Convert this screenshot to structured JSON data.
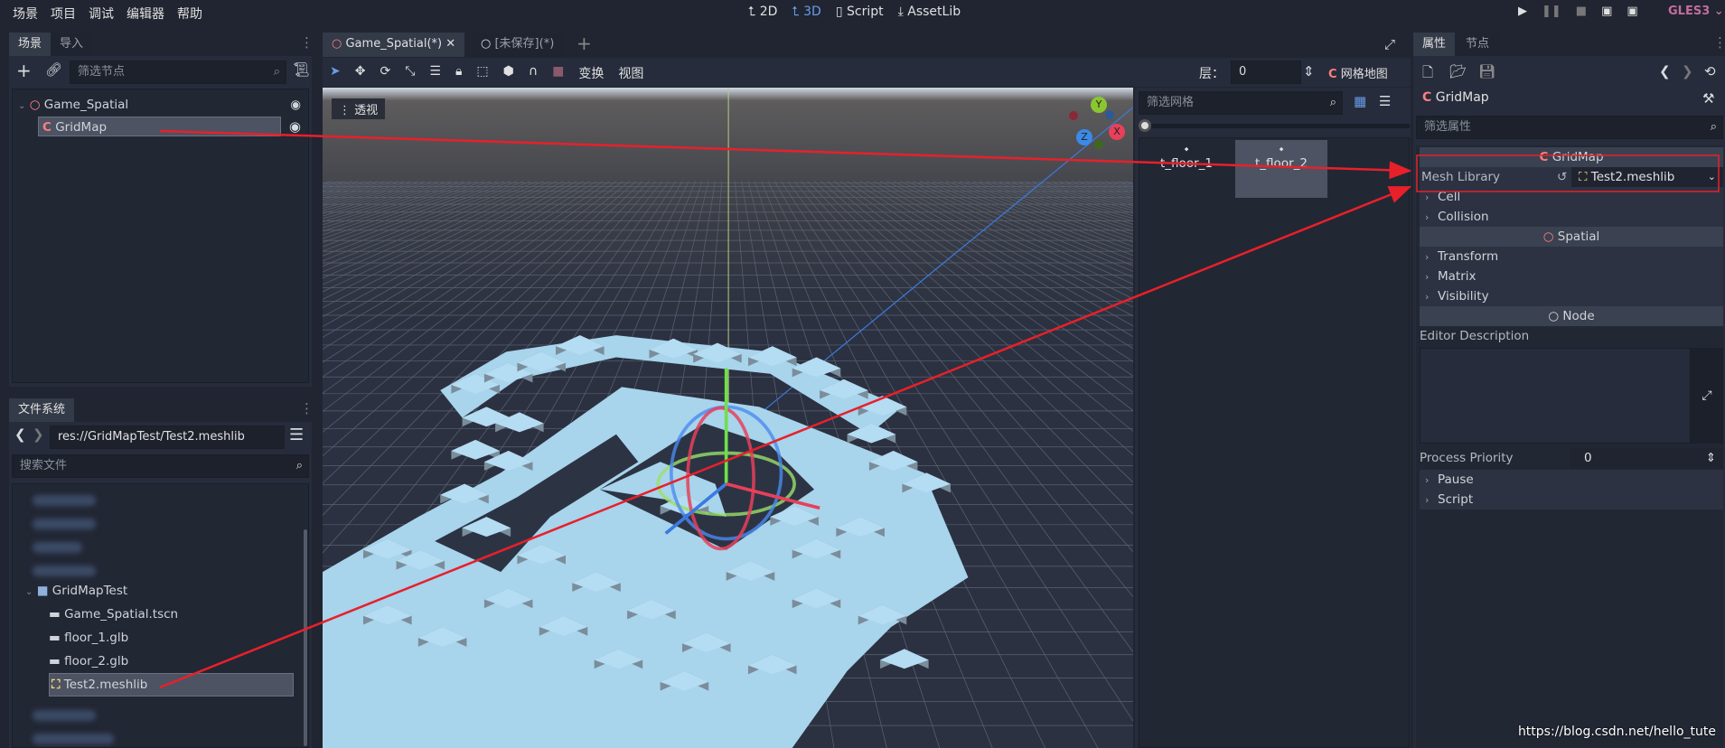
{
  "menu": [
    "场景",
    "项目",
    "调试",
    "编辑器",
    "帮助"
  ],
  "workspaces": {
    "w2d": "2D",
    "w3d": "3D",
    "script": "Script",
    "assetlib": "AssetLib"
  },
  "renderer": "GLES3",
  "scene_dock": {
    "tabs": [
      "场景",
      "导入"
    ],
    "filter_placeholder": "筛选节点",
    "nodes": [
      "Game_Spatial",
      "GridMap"
    ]
  },
  "filesystem": {
    "tab": "文件系统",
    "path": "res://GridMapTest/Test2.meshlib",
    "search_placeholder": "搜索文件",
    "folder": "GridMapTest",
    "files": [
      "Game_Spatial.tscn",
      "floor_1.glb",
      "floor_2.glb",
      "Test2.meshlib"
    ]
  },
  "editor": {
    "tabs": [
      "Game_Spatial(*)",
      "[未保存](*)"
    ],
    "transform": "变换",
    "view": "视图",
    "layer_label": "层：",
    "layer_value": "0",
    "gridmap_label": "网格地图",
    "viewport_menu": "透视",
    "axes": {
      "x": "X",
      "y": "Y",
      "z": "Z"
    }
  },
  "palette": {
    "filter_placeholder": "筛选网格",
    "items": [
      "t_floor_1",
      "t_floor_2"
    ],
    "selected": "t_floor_2"
  },
  "inspector": {
    "tabs": [
      "属性",
      "节点"
    ],
    "object": "GridMap",
    "filter_placeholder": "筛选属性",
    "class_gridmap": "GridMap",
    "mesh_library_label": "Mesh Library",
    "mesh_library_value": "Test2.meshlib",
    "cell": "Cell",
    "collision": "Collision",
    "class_spatial": "Spatial",
    "transform": "Transform",
    "matrix": "Matrix",
    "visibility": "Visibility",
    "class_node": "Node",
    "editor_description": "Editor Description",
    "process_priority": "Process Priority",
    "process_priority_value": "0",
    "pause": "Pause",
    "script": "Script"
  },
  "watermark": "https://blog.csdn.net/hello_tute",
  "colors": {
    "accent": "#699ce8",
    "node_icon": "#fc7f7f",
    "meshlib_icon": "#ffd684",
    "floor": "#a8d4ec",
    "annotation": "#e8202a"
  }
}
